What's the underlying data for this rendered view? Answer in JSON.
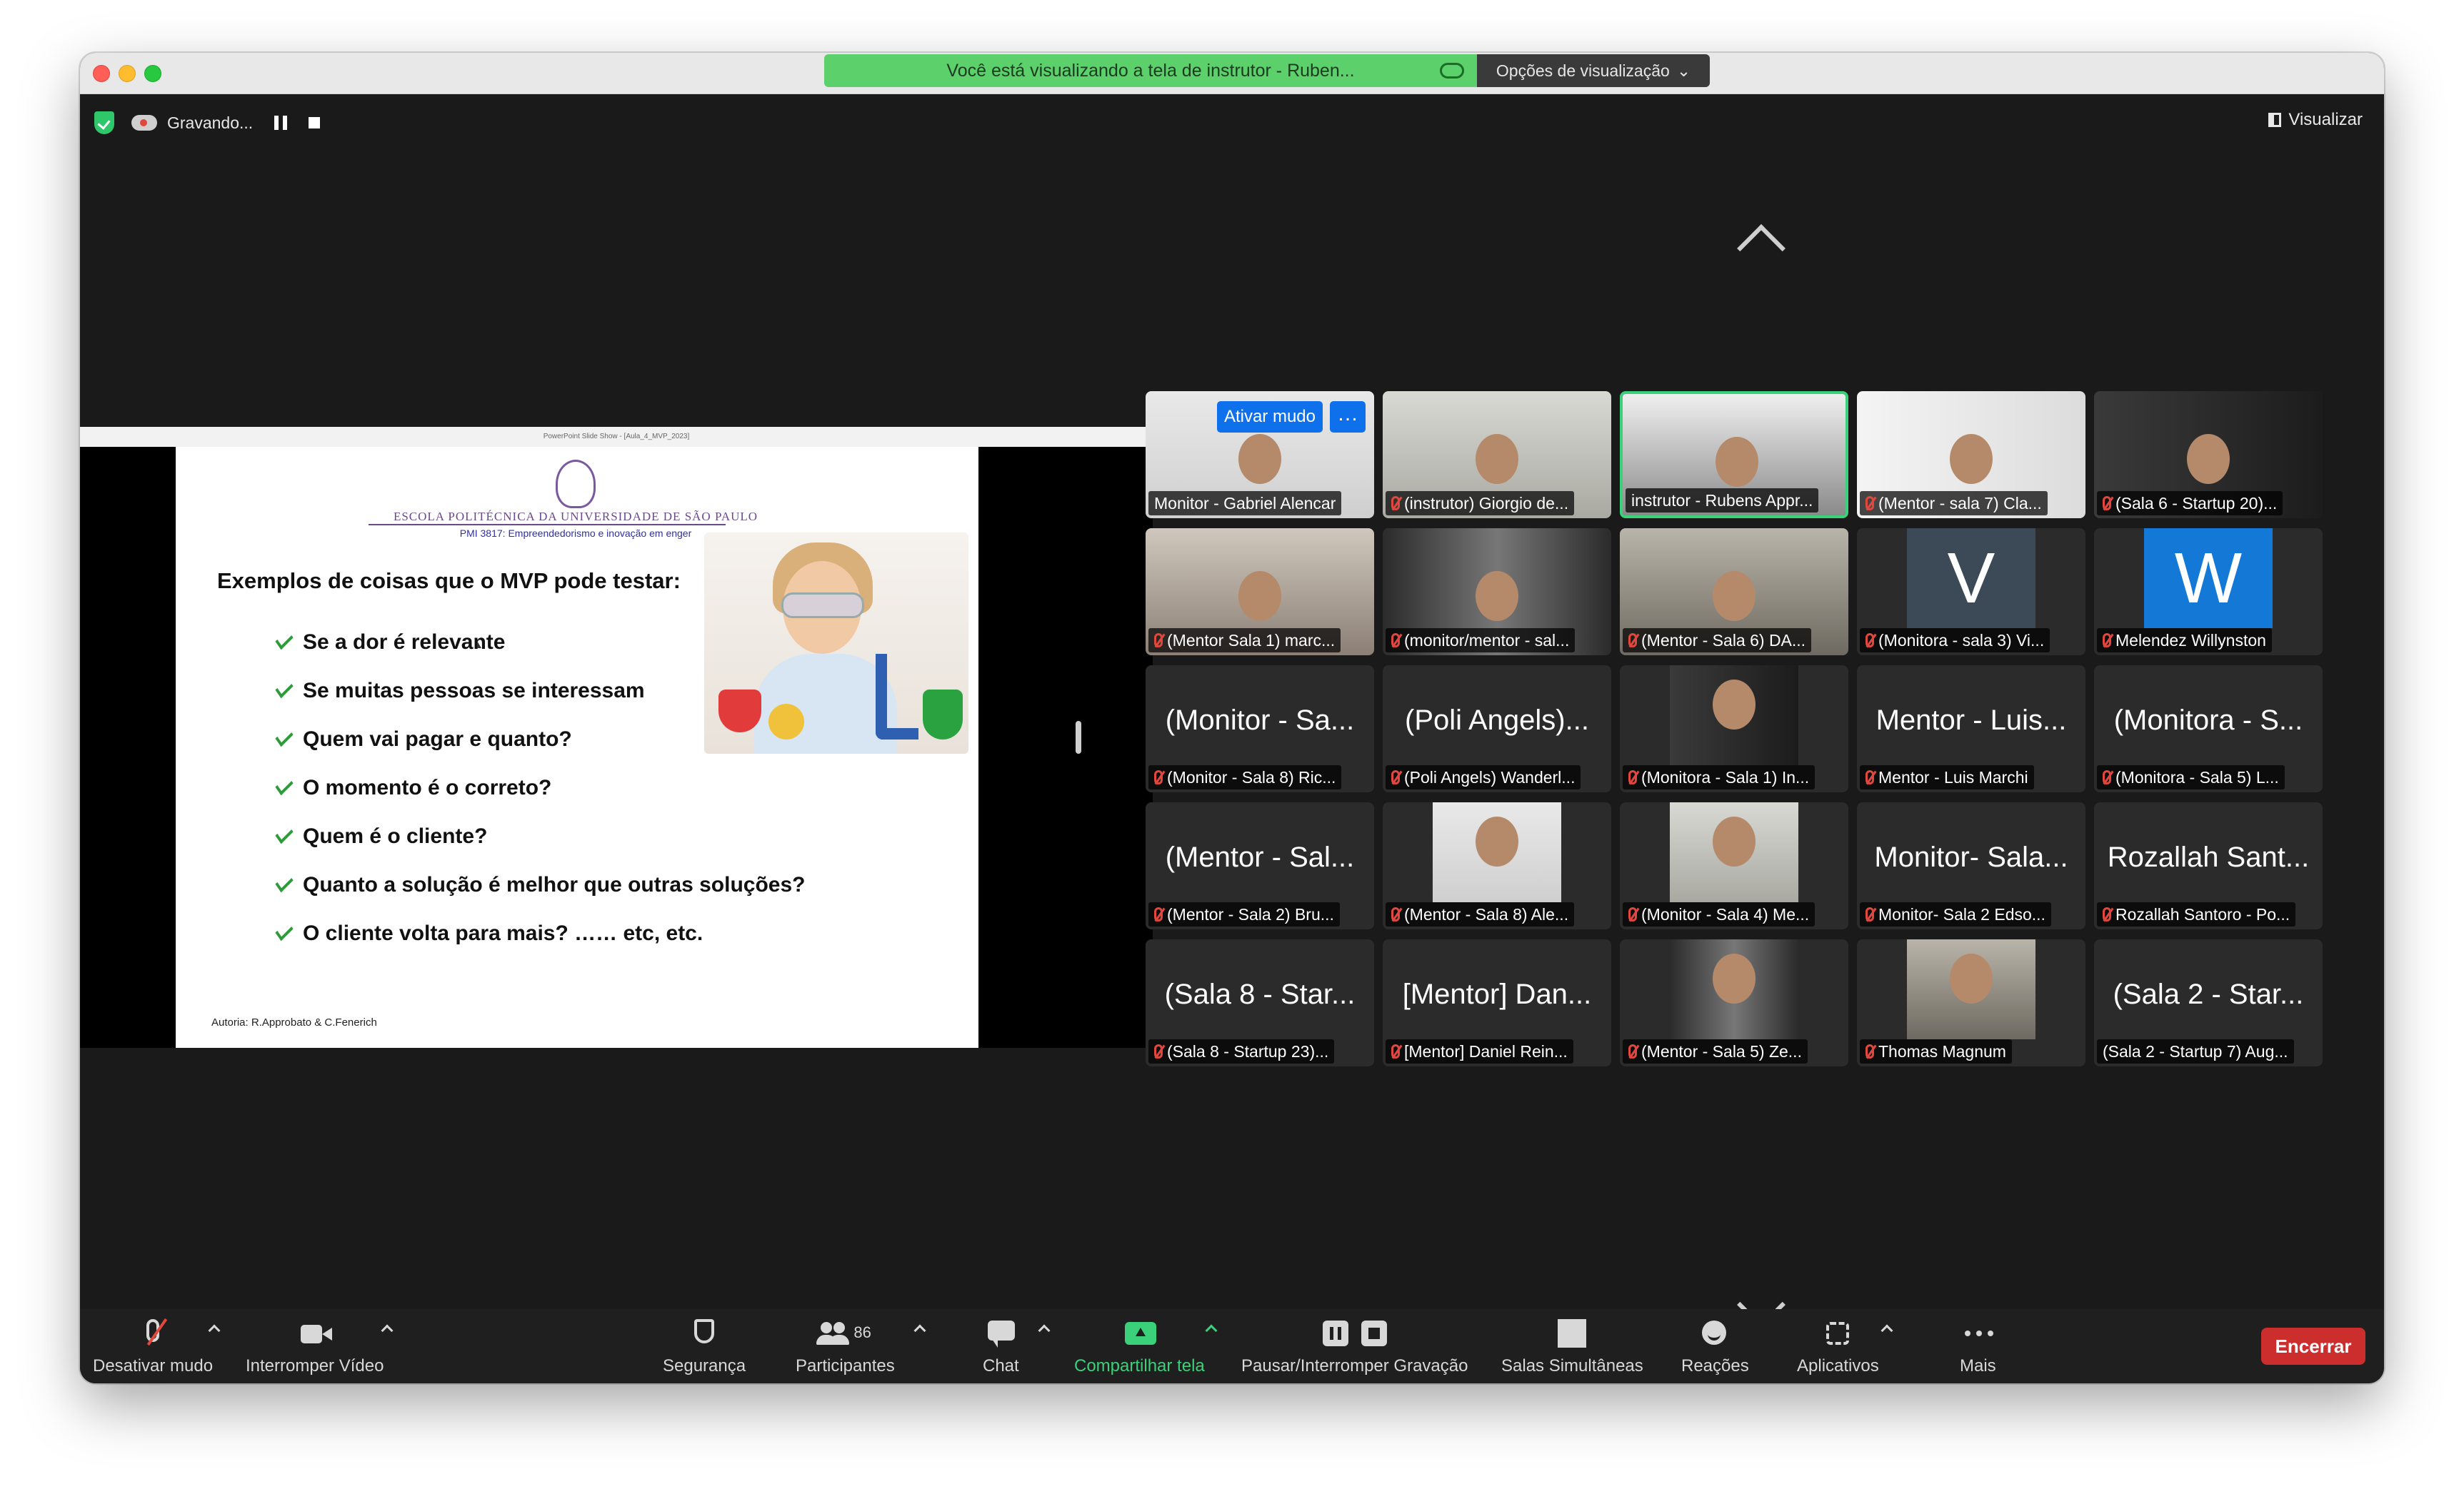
{
  "banner": {
    "viewing": "Você está visualizando a tela de instrutor - Ruben...",
    "options": "Opções de visualização"
  },
  "recording": {
    "label": "Gravando..."
  },
  "view_button": "Visualizar",
  "slide": {
    "window_title": "PowerPoint Slide Show - [Aula_4_MVP_2023]",
    "school": "ESCOLA POLITÉCNICA DA UNIVERSIDADE DE SÃO PAULO",
    "course": "PMI 3817: Empreendedorismo e inovação em enger",
    "heading": "Exemplos de coisas que o MVP pode testar:",
    "bullets": [
      "Se a dor é relevante",
      "Se muitas pessoas se interessam",
      "Quem vai pagar e quanto?",
      "O momento é o correto?",
      "Quem é o  cliente?",
      "Quanto a solução é melhor que outras soluções?",
      "O cliente volta para mais? ……    etc, etc."
    ],
    "author": "Autoria: R.Approbato & C.Fenerich"
  },
  "gallery": {
    "ativar_mudo": "Ativar mudo",
    "more": "…",
    "tiles": [
      {
        "name": "Monitor - Gabriel Alencar",
        "muted": false,
        "big": ""
      },
      {
        "name": "(instrutor) Giorgio de...",
        "muted": true,
        "big": ""
      },
      {
        "name": "instrutor - Rubens Appr...",
        "muted": false,
        "big": "",
        "active": true
      },
      {
        "name": "(Mentor - sala 7) Cla...",
        "muted": true,
        "big": ""
      },
      {
        "name": "(Sala 6 - Startup 20)...",
        "muted": true,
        "big": ""
      },
      {
        "name": "(Mentor Sala 1) marc...",
        "muted": true,
        "big": ""
      },
      {
        "name": "(monitor/mentor - sal...",
        "muted": true,
        "big": ""
      },
      {
        "name": "(Mentor - Sala 6) DA...",
        "muted": true,
        "big": ""
      },
      {
        "name": "(Monitora - sala 3) Vi...",
        "muted": true,
        "big": "",
        "letter": "V"
      },
      {
        "name": "Melendez Willynston",
        "muted": true,
        "big": "",
        "letter": "W"
      },
      {
        "name": "(Monitor - Sala 8) Ric...",
        "muted": true,
        "big": "(Monitor - Sa..."
      },
      {
        "name": "(Poli Angels) Wanderl...",
        "muted": true,
        "big": "(Poli Angels)..."
      },
      {
        "name": "(Monitora - Sala 1) In...",
        "muted": true,
        "big": ""
      },
      {
        "name": "Mentor - Luis Marchi",
        "muted": true,
        "big": "Mentor - Luis..."
      },
      {
        "name": "(Monitora - Sala 5) L...",
        "muted": true,
        "big": "(Monitora - S..."
      },
      {
        "name": "(Mentor - Sala 2) Bru...",
        "muted": true,
        "big": "(Mentor - Sal..."
      },
      {
        "name": "(Mentor - Sala 8) Ale...",
        "muted": true,
        "big": ""
      },
      {
        "name": "(Monitor - Sala 4) Me...",
        "muted": true,
        "big": ""
      },
      {
        "name": "Monitor- Sala 2 Edso...",
        "muted": true,
        "big": "Monitor- Sala..."
      },
      {
        "name": "Rozallah Santoro - Po...",
        "muted": true,
        "big": "Rozallah Sant..."
      },
      {
        "name": "(Sala 8 - Startup 23)...",
        "muted": true,
        "big": "(Sala 8 - Star..."
      },
      {
        "name": "[Mentor] Daniel Rein...",
        "muted": true,
        "big": "[Mentor] Dan..."
      },
      {
        "name": "(Mentor - Sala 5) Ze...",
        "muted": true,
        "big": ""
      },
      {
        "name": "Thomas Magnum",
        "muted": true,
        "big": ""
      },
      {
        "name": "(Sala 2 - Startup 7) Aug...",
        "muted": false,
        "big": "(Sala 2 - Star..."
      }
    ]
  },
  "toolbar": {
    "mute": "Desativar mudo",
    "video": "Interromper Vídeo",
    "security": "Segurança",
    "participants": "Participantes",
    "participants_count": "86",
    "chat": "Chat",
    "share": "Compartilhar tela",
    "record": "Pausar/Interromper Gravação",
    "rooms": "Salas Simultâneas",
    "reactions": "Reações",
    "apps": "Aplicativos",
    "more": "Mais",
    "end": "Encerrar"
  },
  "colors": {
    "accent_green": "#3ad17a",
    "end_red": "#cc2d2d",
    "banner_green": "#5bd06b",
    "mute_blue": "#0e71eb"
  }
}
